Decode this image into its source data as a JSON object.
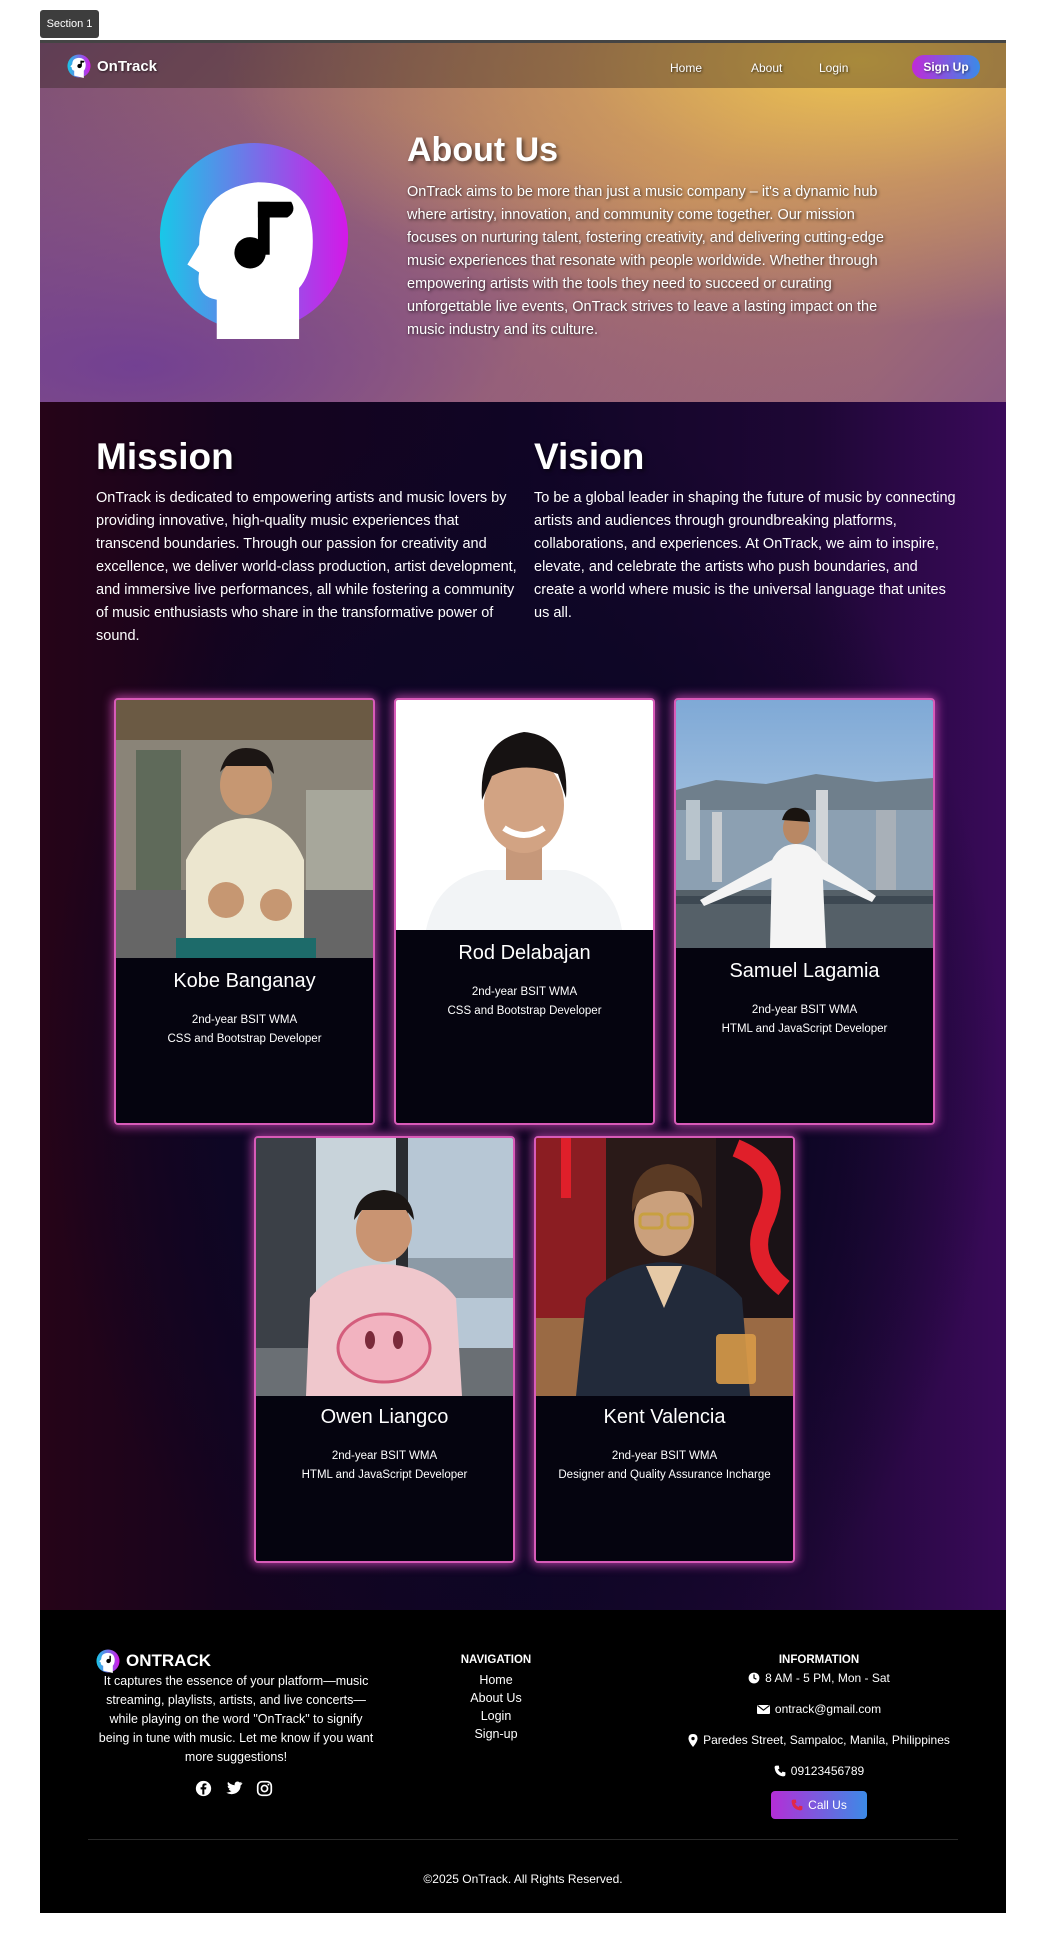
{
  "section_label": "Section 1",
  "nav": {
    "brand": "OnTrack",
    "links": [
      "Home",
      "About",
      "Login"
    ],
    "signup": "Sign Up"
  },
  "hero": {
    "title": "About Us",
    "text": "OnTrack aims to be more than just a music company – it's a dynamic hub where artistry, innovation, and community come together. Our mission focuses on nurturing talent, fostering creativity, and delivering cutting-edge music experiences that resonate with people worldwide. Whether through empowering artists with the tools they need to succeed or curating unforgettable live events, OnTrack strives to leave a lasting impact on the music industry and its culture."
  },
  "mission": {
    "title": "Mission",
    "text": "OnTrack is dedicated to empowering artists and music lovers by providing innovative, high-quality music experiences that transcend boundaries. Through our passion for creativity and excellence, we deliver world-class production, artist development, and immersive live performances, all while fostering a community of music enthusiasts who share in the transformative power of sound."
  },
  "vision": {
    "title": "Vision",
    "text": "To be a global leader in shaping the future of music by connecting artists and audiences through groundbreaking platforms, collaborations, and experiences. At OnTrack, we aim to inspire, elevate, and celebrate the artists who push boundaries, and create a world where music is the universal language that unites us all."
  },
  "team": [
    {
      "name": "Kobe Banganay",
      "year": "2nd-year BSIT WMA",
      "role": "CSS and Bootstrap Developer"
    },
    {
      "name": "Rod Delabajan",
      "year": "2nd-year BSIT WMA",
      "role": "CSS and Bootstrap Developer"
    },
    {
      "name": "Samuel Lagamia",
      "year": "2nd-year BSIT WMA",
      "role": "HTML and JavaScript Developer"
    },
    {
      "name": "Owen Liangco",
      "year": "2nd-year BSIT WMA",
      "role": "HTML and JavaScript Developer"
    },
    {
      "name": "Kent Valencia",
      "year": "2nd-year BSIT WMA",
      "role": "Designer and Quality Assurance Incharge"
    }
  ],
  "footer": {
    "brand": "ONTRACK",
    "description": "It captures the essence of your platform—music streaming, playlists, artists, and live concerts—while playing on the word \"OnTrack\" to signify being in tune with music. Let me know if you want more suggestions!",
    "navigation_title": "NAVIGATION",
    "navigation": [
      "Home",
      "About Us",
      "Login",
      "Sign-up"
    ],
    "information_title": "INFORMATION",
    "hours": "8 AM - 5 PM, Mon - Sat",
    "email": "ontrack@gmail.com",
    "address": "Paredes Street, Sampaloc, Manila, Philippines",
    "phone": "09123456789",
    "call_button": "Call Us",
    "copyright": "©2025 OnTrack. All Rights Reserved."
  },
  "colors": {
    "accent_pink": "#d85bb8",
    "accent_gradient_start": "#c02ad8",
    "accent_gradient_end": "#3a8be8",
    "card_bg": "#05040f"
  }
}
